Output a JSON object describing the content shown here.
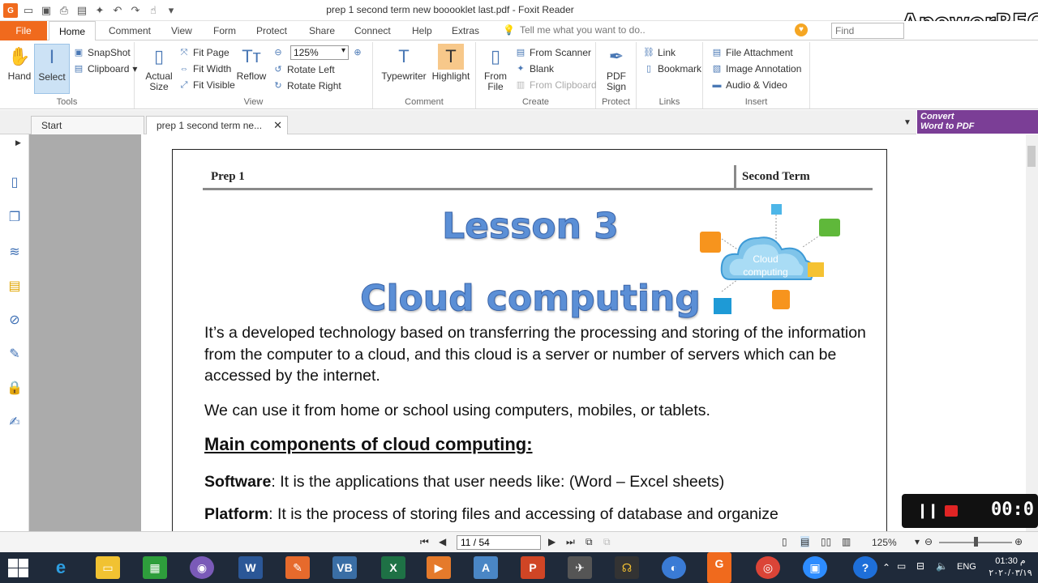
{
  "window": {
    "title": "prep 1 second term new booooklet last.pdf - Foxit Reader",
    "watermark": "ApowerREC"
  },
  "menu": {
    "file": "File",
    "tabs": [
      "Home",
      "Comment",
      "View",
      "Form",
      "Protect",
      "Share",
      "Connect",
      "Help",
      "Extras"
    ],
    "tell_me": "Tell me what you want to do..",
    "find_placeholder": "Find"
  },
  "ribbon": {
    "tools": {
      "label": "Tools",
      "hand": "Hand",
      "select": "Select",
      "snapshot": "SnapShot",
      "clipboard": "Clipboard"
    },
    "view": {
      "label": "View",
      "actual_size_1": "Actual",
      "actual_size_2": "Size",
      "fit_page": "Fit Page",
      "fit_width": "Fit Width",
      "fit_visible": "Fit Visible",
      "reflow": "Reflow",
      "zoom_value": "125%",
      "rotate_left": "Rotate Left",
      "rotate_right": "Rotate Right"
    },
    "comment": {
      "label": "Comment",
      "typewriter": "Typewriter",
      "highlight": "Highlight"
    },
    "create": {
      "label": "Create",
      "from_file_1": "From",
      "from_file_2": "File",
      "from_scanner": "From Scanner",
      "blank": "Blank",
      "from_clipboard": "From Clipboard"
    },
    "protect": {
      "label": "Protect",
      "pdf_sign_1": "PDF",
      "pdf_sign_2": "Sign"
    },
    "links": {
      "label": "Links",
      "link": "Link",
      "bookmark": "Bookmark"
    },
    "insert": {
      "label": "Insert",
      "file_attachment": "File Attachment",
      "image_annotation": "Image Annotation",
      "audio_video": "Audio & Video"
    }
  },
  "tabs": {
    "start": "Start",
    "document": "prep 1 second term ne...",
    "convert_1": "Convert",
    "convert_2": "Word to PDF"
  },
  "document": {
    "header_left": "Prep 1",
    "header_right": "Second Term",
    "lesson_number": "Lesson 3",
    "lesson_title": "Cloud computing",
    "cloud_label_1": "Cloud",
    "cloud_label_2": "computing",
    "paragraph_1": "It’s a developed technology based on transferring the processing and storing of the information from the computer to a cloud, and this cloud is a server or number of servers which can be accessed by the internet.",
    "paragraph_2": "We can use it from home or school using computers, mobiles, or tablets.",
    "section_heading": "Main components of cloud computing:",
    "components": [
      {
        "term": "Software",
        "text": ": It is the applications that user needs like: (Word – Excel sheets)"
      },
      {
        "term": "Platform",
        "text": ": It is the process of storing files and accessing of database and organize"
      }
    ]
  },
  "recorder": {
    "time": "00:0"
  },
  "status": {
    "page_indicator": "11 / 54",
    "zoom": "125%"
  },
  "tray": {
    "lang": "ENG",
    "time": "01:30 م",
    "date": "٢٠٢٠/٠٣/١٩"
  },
  "colors": {
    "accent": "#f06a1d",
    "title_blue": "#5b8fd6",
    "convert_purple": "#7b3e96",
    "taskbar": "#1f2a3a"
  }
}
